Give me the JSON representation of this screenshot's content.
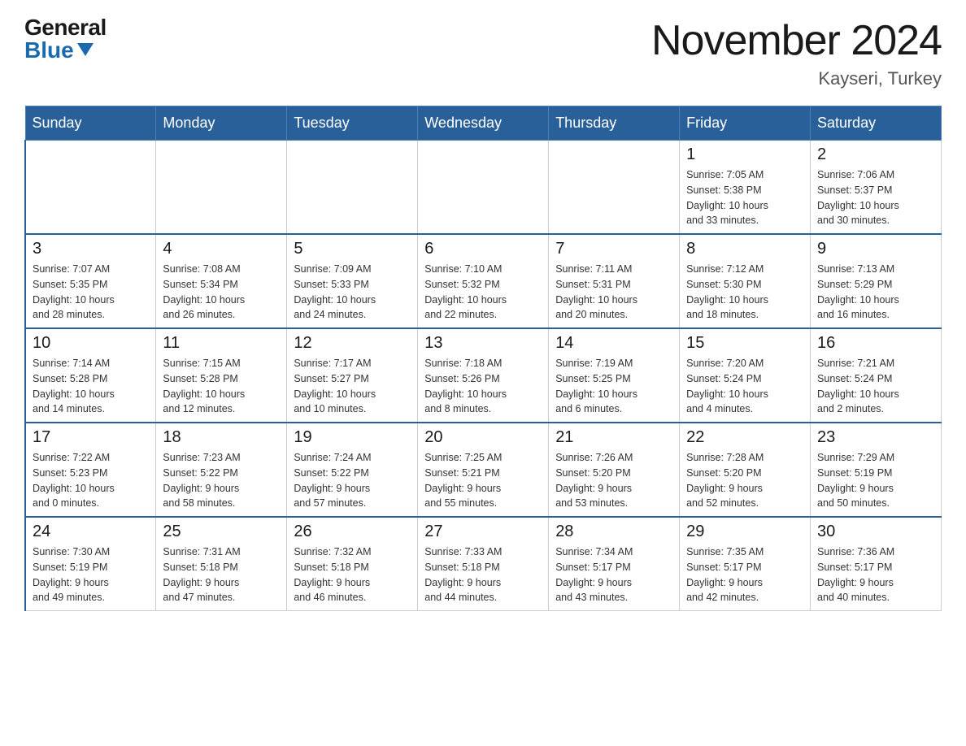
{
  "header": {
    "logo_general": "General",
    "logo_blue": "Blue",
    "month_title": "November 2024",
    "location": "Kayseri, Turkey"
  },
  "weekdays": [
    "Sunday",
    "Monday",
    "Tuesday",
    "Wednesday",
    "Thursday",
    "Friday",
    "Saturday"
  ],
  "weeks": [
    [
      {
        "day": "",
        "info": ""
      },
      {
        "day": "",
        "info": ""
      },
      {
        "day": "",
        "info": ""
      },
      {
        "day": "",
        "info": ""
      },
      {
        "day": "",
        "info": ""
      },
      {
        "day": "1",
        "info": "Sunrise: 7:05 AM\nSunset: 5:38 PM\nDaylight: 10 hours\nand 33 minutes."
      },
      {
        "day": "2",
        "info": "Sunrise: 7:06 AM\nSunset: 5:37 PM\nDaylight: 10 hours\nand 30 minutes."
      }
    ],
    [
      {
        "day": "3",
        "info": "Sunrise: 7:07 AM\nSunset: 5:35 PM\nDaylight: 10 hours\nand 28 minutes."
      },
      {
        "day": "4",
        "info": "Sunrise: 7:08 AM\nSunset: 5:34 PM\nDaylight: 10 hours\nand 26 minutes."
      },
      {
        "day": "5",
        "info": "Sunrise: 7:09 AM\nSunset: 5:33 PM\nDaylight: 10 hours\nand 24 minutes."
      },
      {
        "day": "6",
        "info": "Sunrise: 7:10 AM\nSunset: 5:32 PM\nDaylight: 10 hours\nand 22 minutes."
      },
      {
        "day": "7",
        "info": "Sunrise: 7:11 AM\nSunset: 5:31 PM\nDaylight: 10 hours\nand 20 minutes."
      },
      {
        "day": "8",
        "info": "Sunrise: 7:12 AM\nSunset: 5:30 PM\nDaylight: 10 hours\nand 18 minutes."
      },
      {
        "day": "9",
        "info": "Sunrise: 7:13 AM\nSunset: 5:29 PM\nDaylight: 10 hours\nand 16 minutes."
      }
    ],
    [
      {
        "day": "10",
        "info": "Sunrise: 7:14 AM\nSunset: 5:28 PM\nDaylight: 10 hours\nand 14 minutes."
      },
      {
        "day": "11",
        "info": "Sunrise: 7:15 AM\nSunset: 5:28 PM\nDaylight: 10 hours\nand 12 minutes."
      },
      {
        "day": "12",
        "info": "Sunrise: 7:17 AM\nSunset: 5:27 PM\nDaylight: 10 hours\nand 10 minutes."
      },
      {
        "day": "13",
        "info": "Sunrise: 7:18 AM\nSunset: 5:26 PM\nDaylight: 10 hours\nand 8 minutes."
      },
      {
        "day": "14",
        "info": "Sunrise: 7:19 AM\nSunset: 5:25 PM\nDaylight: 10 hours\nand 6 minutes."
      },
      {
        "day": "15",
        "info": "Sunrise: 7:20 AM\nSunset: 5:24 PM\nDaylight: 10 hours\nand 4 minutes."
      },
      {
        "day": "16",
        "info": "Sunrise: 7:21 AM\nSunset: 5:24 PM\nDaylight: 10 hours\nand 2 minutes."
      }
    ],
    [
      {
        "day": "17",
        "info": "Sunrise: 7:22 AM\nSunset: 5:23 PM\nDaylight: 10 hours\nand 0 minutes."
      },
      {
        "day": "18",
        "info": "Sunrise: 7:23 AM\nSunset: 5:22 PM\nDaylight: 9 hours\nand 58 minutes."
      },
      {
        "day": "19",
        "info": "Sunrise: 7:24 AM\nSunset: 5:22 PM\nDaylight: 9 hours\nand 57 minutes."
      },
      {
        "day": "20",
        "info": "Sunrise: 7:25 AM\nSunset: 5:21 PM\nDaylight: 9 hours\nand 55 minutes."
      },
      {
        "day": "21",
        "info": "Sunrise: 7:26 AM\nSunset: 5:20 PM\nDaylight: 9 hours\nand 53 minutes."
      },
      {
        "day": "22",
        "info": "Sunrise: 7:28 AM\nSunset: 5:20 PM\nDaylight: 9 hours\nand 52 minutes."
      },
      {
        "day": "23",
        "info": "Sunrise: 7:29 AM\nSunset: 5:19 PM\nDaylight: 9 hours\nand 50 minutes."
      }
    ],
    [
      {
        "day": "24",
        "info": "Sunrise: 7:30 AM\nSunset: 5:19 PM\nDaylight: 9 hours\nand 49 minutes."
      },
      {
        "day": "25",
        "info": "Sunrise: 7:31 AM\nSunset: 5:18 PM\nDaylight: 9 hours\nand 47 minutes."
      },
      {
        "day": "26",
        "info": "Sunrise: 7:32 AM\nSunset: 5:18 PM\nDaylight: 9 hours\nand 46 minutes."
      },
      {
        "day": "27",
        "info": "Sunrise: 7:33 AM\nSunset: 5:18 PM\nDaylight: 9 hours\nand 44 minutes."
      },
      {
        "day": "28",
        "info": "Sunrise: 7:34 AM\nSunset: 5:17 PM\nDaylight: 9 hours\nand 43 minutes."
      },
      {
        "day": "29",
        "info": "Sunrise: 7:35 AM\nSunset: 5:17 PM\nDaylight: 9 hours\nand 42 minutes."
      },
      {
        "day": "30",
        "info": "Sunrise: 7:36 AM\nSunset: 5:17 PM\nDaylight: 9 hours\nand 40 minutes."
      }
    ]
  ]
}
